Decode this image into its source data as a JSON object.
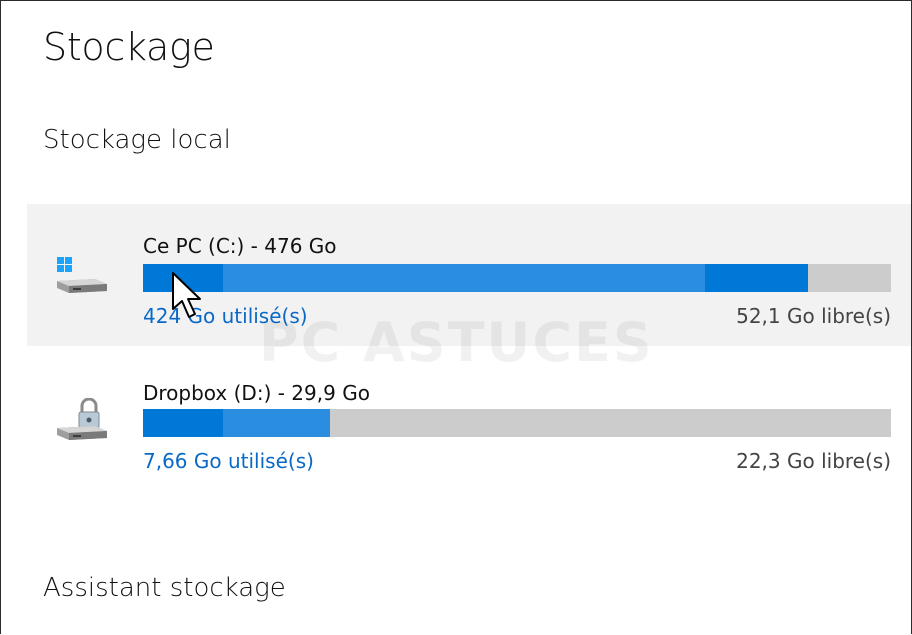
{
  "page": {
    "title": "Stockage"
  },
  "local_storage": {
    "heading": "Stockage local",
    "drives": [
      {
        "name": "Ce PC (C:) - 476 Go",
        "used_label": "424 Go utilisé(s)",
        "free_label": "52,1 Go libre(s)",
        "used_fraction": 0.89,
        "icon": "windows-drive-icon"
      },
      {
        "name": "Dropbox (D:) - 29,9 Go",
        "used_label": "7,66 Go utilisé(s)",
        "free_label": "22,3 Go libre(s)",
        "used_fraction": 0.256,
        "icon": "locked-drive-icon"
      }
    ]
  },
  "storage_sense": {
    "heading": "Assistant stockage"
  },
  "watermark": "PC ASTUCES",
  "colors": {
    "accent": "#0078d7",
    "accent_light": "#2a8de0",
    "link": "#0a69c7",
    "bar_empty": "#cccccc",
    "hover_background": "#f2f2f2"
  }
}
